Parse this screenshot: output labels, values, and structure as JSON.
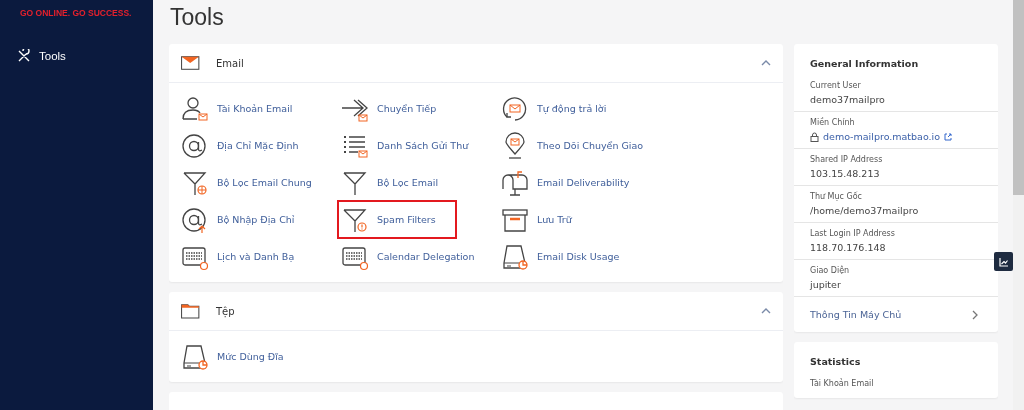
{
  "sidebar": {
    "tagline": "GO ONLINE. GO SUCCESS.",
    "items": [
      {
        "label": "Tools"
      }
    ]
  },
  "page_title": "Tools",
  "sections": [
    {
      "title": "Email",
      "expanded": true,
      "items": [
        {
          "label": "Tài Khoản Email",
          "highlighted": false
        },
        {
          "label": "Chuyển Tiếp",
          "highlighted": false
        },
        {
          "label": "Tự động trả lời",
          "highlighted": false
        },
        {
          "label": "Địa Chỉ Mặc Định",
          "highlighted": false
        },
        {
          "label": "Danh Sách Gửi Thư",
          "highlighted": false
        },
        {
          "label": "Theo Dõi Chuyển Giao",
          "highlighted": false
        },
        {
          "label": "Bộ Lọc Email Chung",
          "highlighted": false
        },
        {
          "label": "Bộ Lọc Email",
          "highlighted": false
        },
        {
          "label": "Email Deliverability",
          "highlighted": false
        },
        {
          "label": "Bộ Nhập Địa Chỉ",
          "highlighted": false
        },
        {
          "label": "Spam Filters",
          "highlighted": true
        },
        {
          "label": "Lưu Trữ",
          "highlighted": false
        },
        {
          "label": "Lịch và Danh Bạ",
          "highlighted": false
        },
        {
          "label": "Calendar Delegation",
          "highlighted": false
        },
        {
          "label": "Email Disk Usage",
          "highlighted": false
        }
      ]
    },
    {
      "title": "Tệp",
      "expanded": true,
      "items": [
        {
          "label": "Mức Dùng Đĩa",
          "highlighted": false
        }
      ]
    }
  ],
  "general_information": {
    "title": "General Information",
    "rows": [
      {
        "label": "Current User",
        "value": "demo37mailpro",
        "kind": "text"
      },
      {
        "label": "Miền Chính",
        "value": "demo-mailpro.matbao.io",
        "kind": "link"
      },
      {
        "label": "Shared IP Address",
        "value": "103.15.48.213",
        "kind": "text"
      },
      {
        "label": "Thư Mục Gốc",
        "value": "/home/demo37mailpro",
        "kind": "text"
      },
      {
        "label": "Last Login IP Address",
        "value": "118.70.176.148",
        "kind": "text"
      },
      {
        "label": "Giao Diện",
        "value": "jupiter",
        "kind": "text"
      }
    ],
    "more_link": "Thông Tin Máy Chủ"
  },
  "statistics": {
    "title": "Statistics",
    "rows": [
      {
        "label": "Tài Khoản Email"
      }
    ]
  }
}
